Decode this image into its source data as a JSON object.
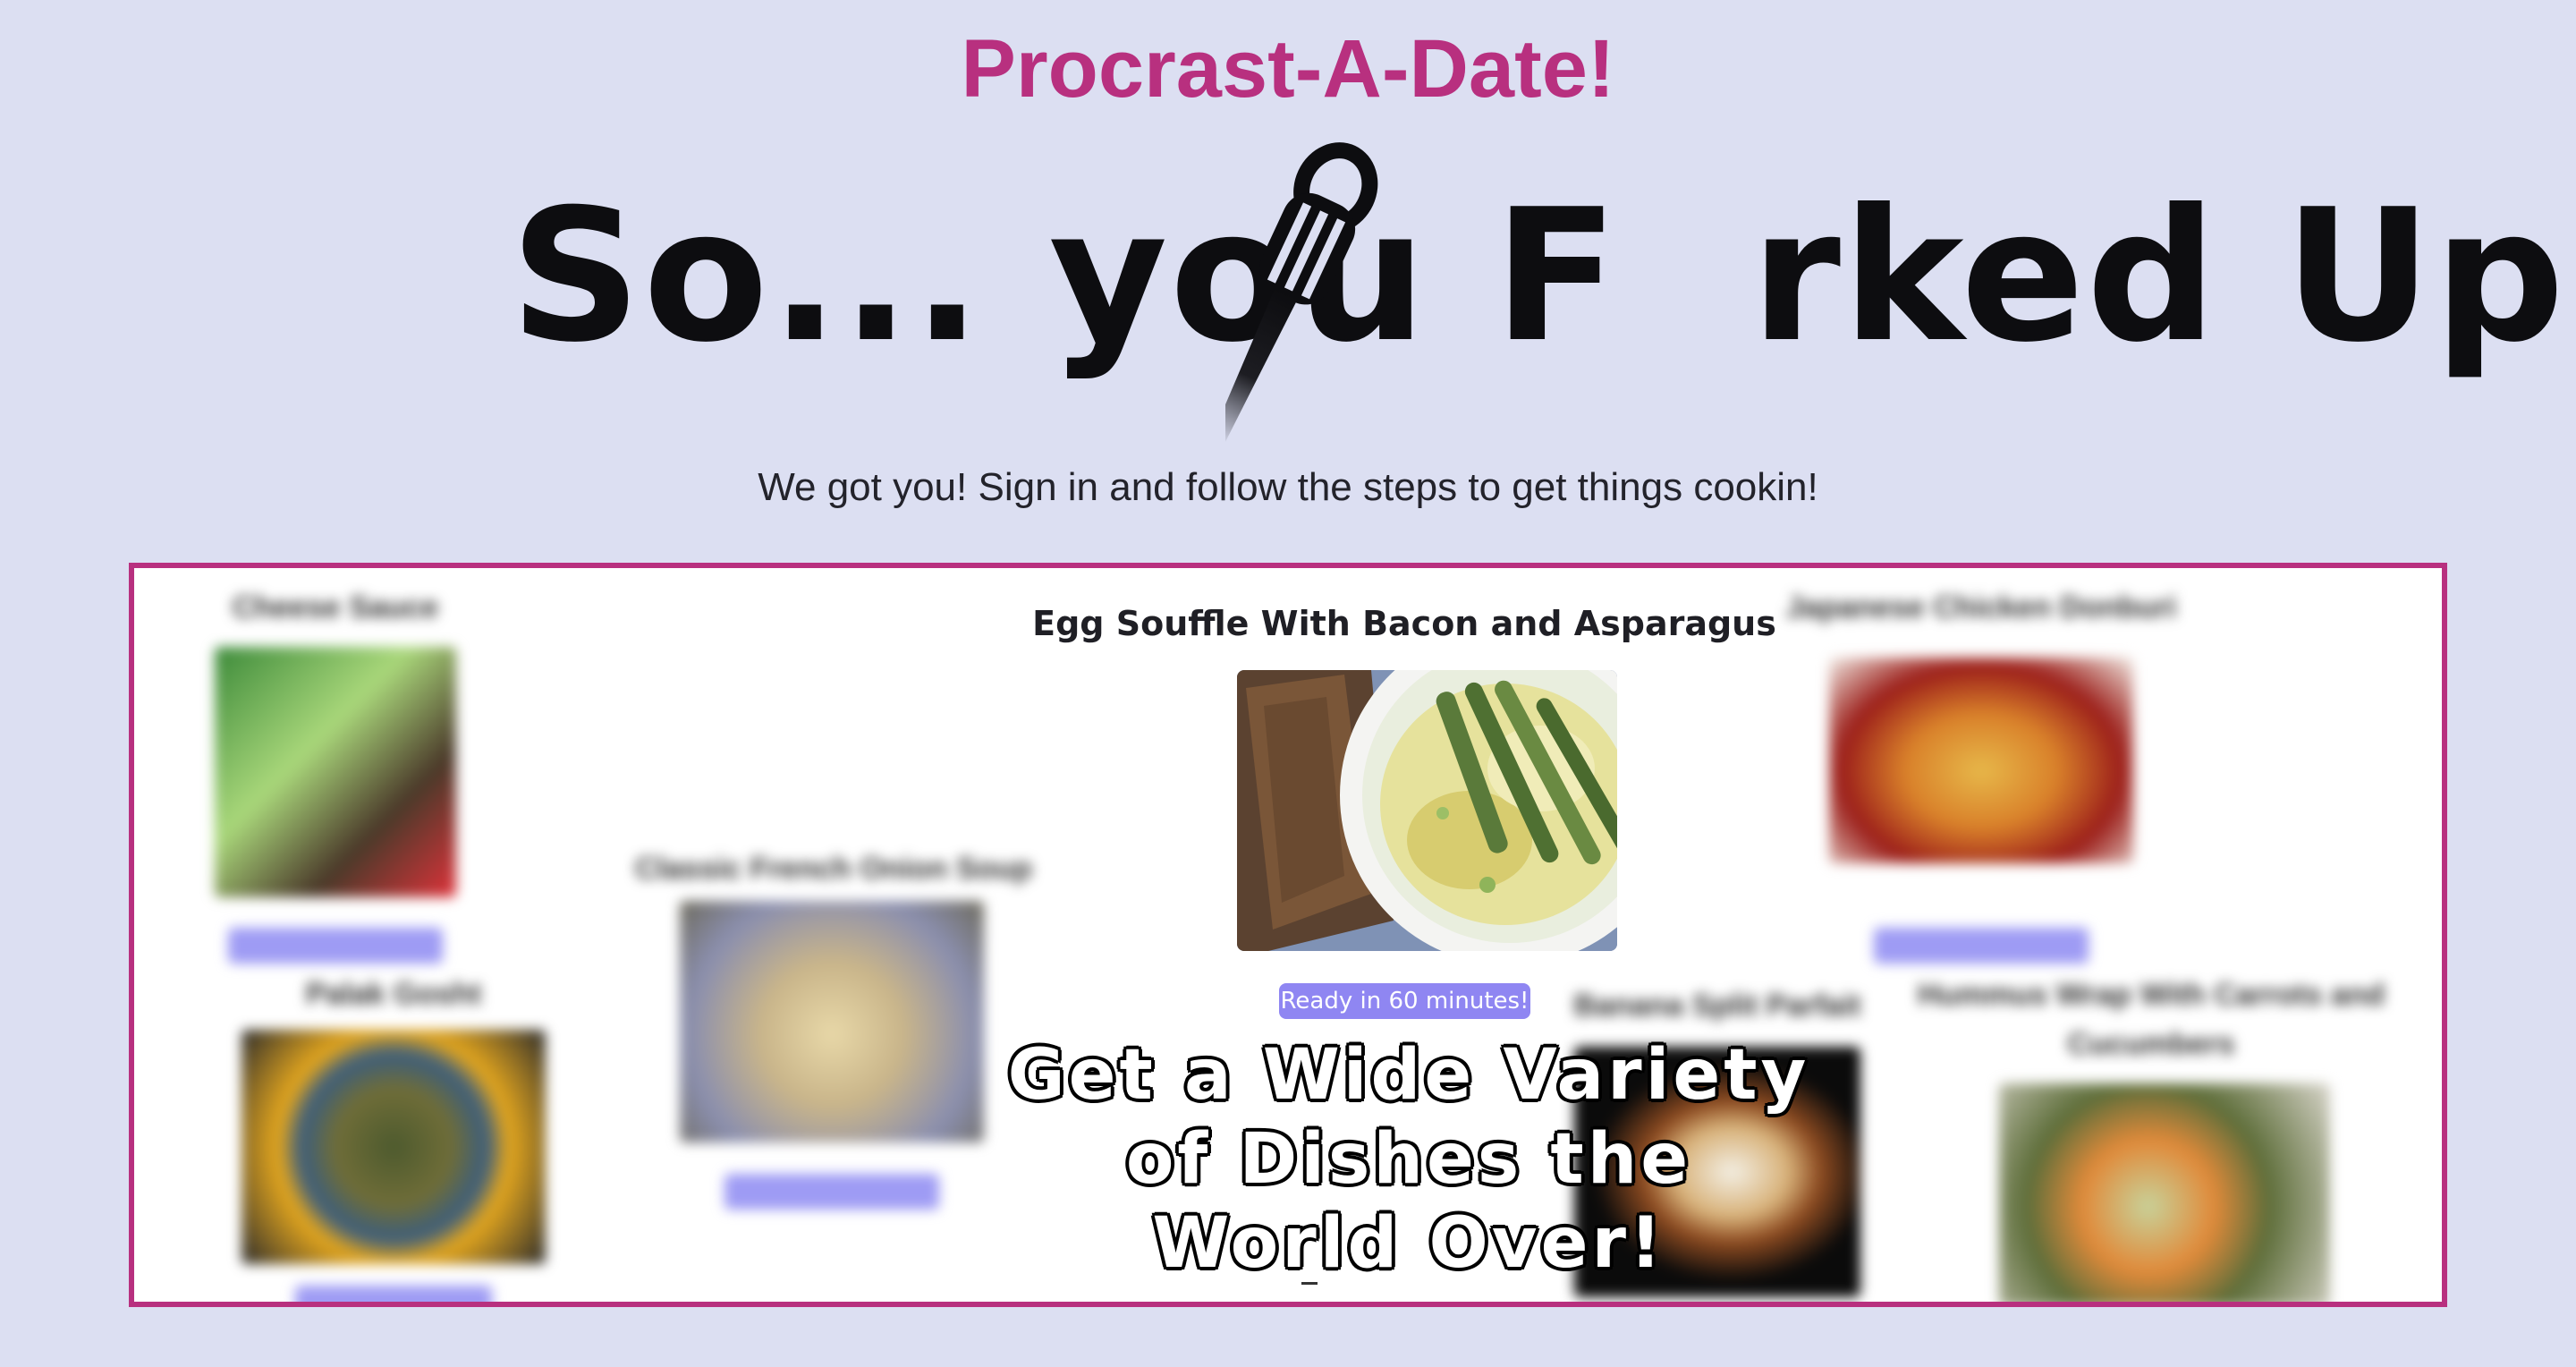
{
  "header": {
    "app_title": "Procrast-A-Date!",
    "logo_text": "So... you F  rked Up",
    "tagline": "We got you! Sign in and follow the steps to get things cookin!"
  },
  "featured_recipe": {
    "title": "Egg Souffle With Bacon and Asparagus",
    "ready_label": "Ready in 60 minutes!"
  },
  "background_recipes": [
    {
      "title": "Cheese Sauce"
    },
    {
      "title": "Classic French Onion Soup"
    },
    {
      "title": "Palak Gosht"
    },
    {
      "title": "Japanese Chicken Donburi"
    },
    {
      "title": "Banana Split Parfait"
    },
    {
      "title": "Hummus Wrap With Carrots and Cucumbers"
    }
  ],
  "promo": {
    "line1": "Get a Wide Variety",
    "line2": "of Dishes the",
    "line3": "World Over!"
  },
  "colors": {
    "page_background": "#dcdff2",
    "accent": "#b8307f",
    "badge": "#8f86f2",
    "logo_text": "#0d0d10"
  },
  "icons": {
    "logo_fork": "fork-icon"
  }
}
